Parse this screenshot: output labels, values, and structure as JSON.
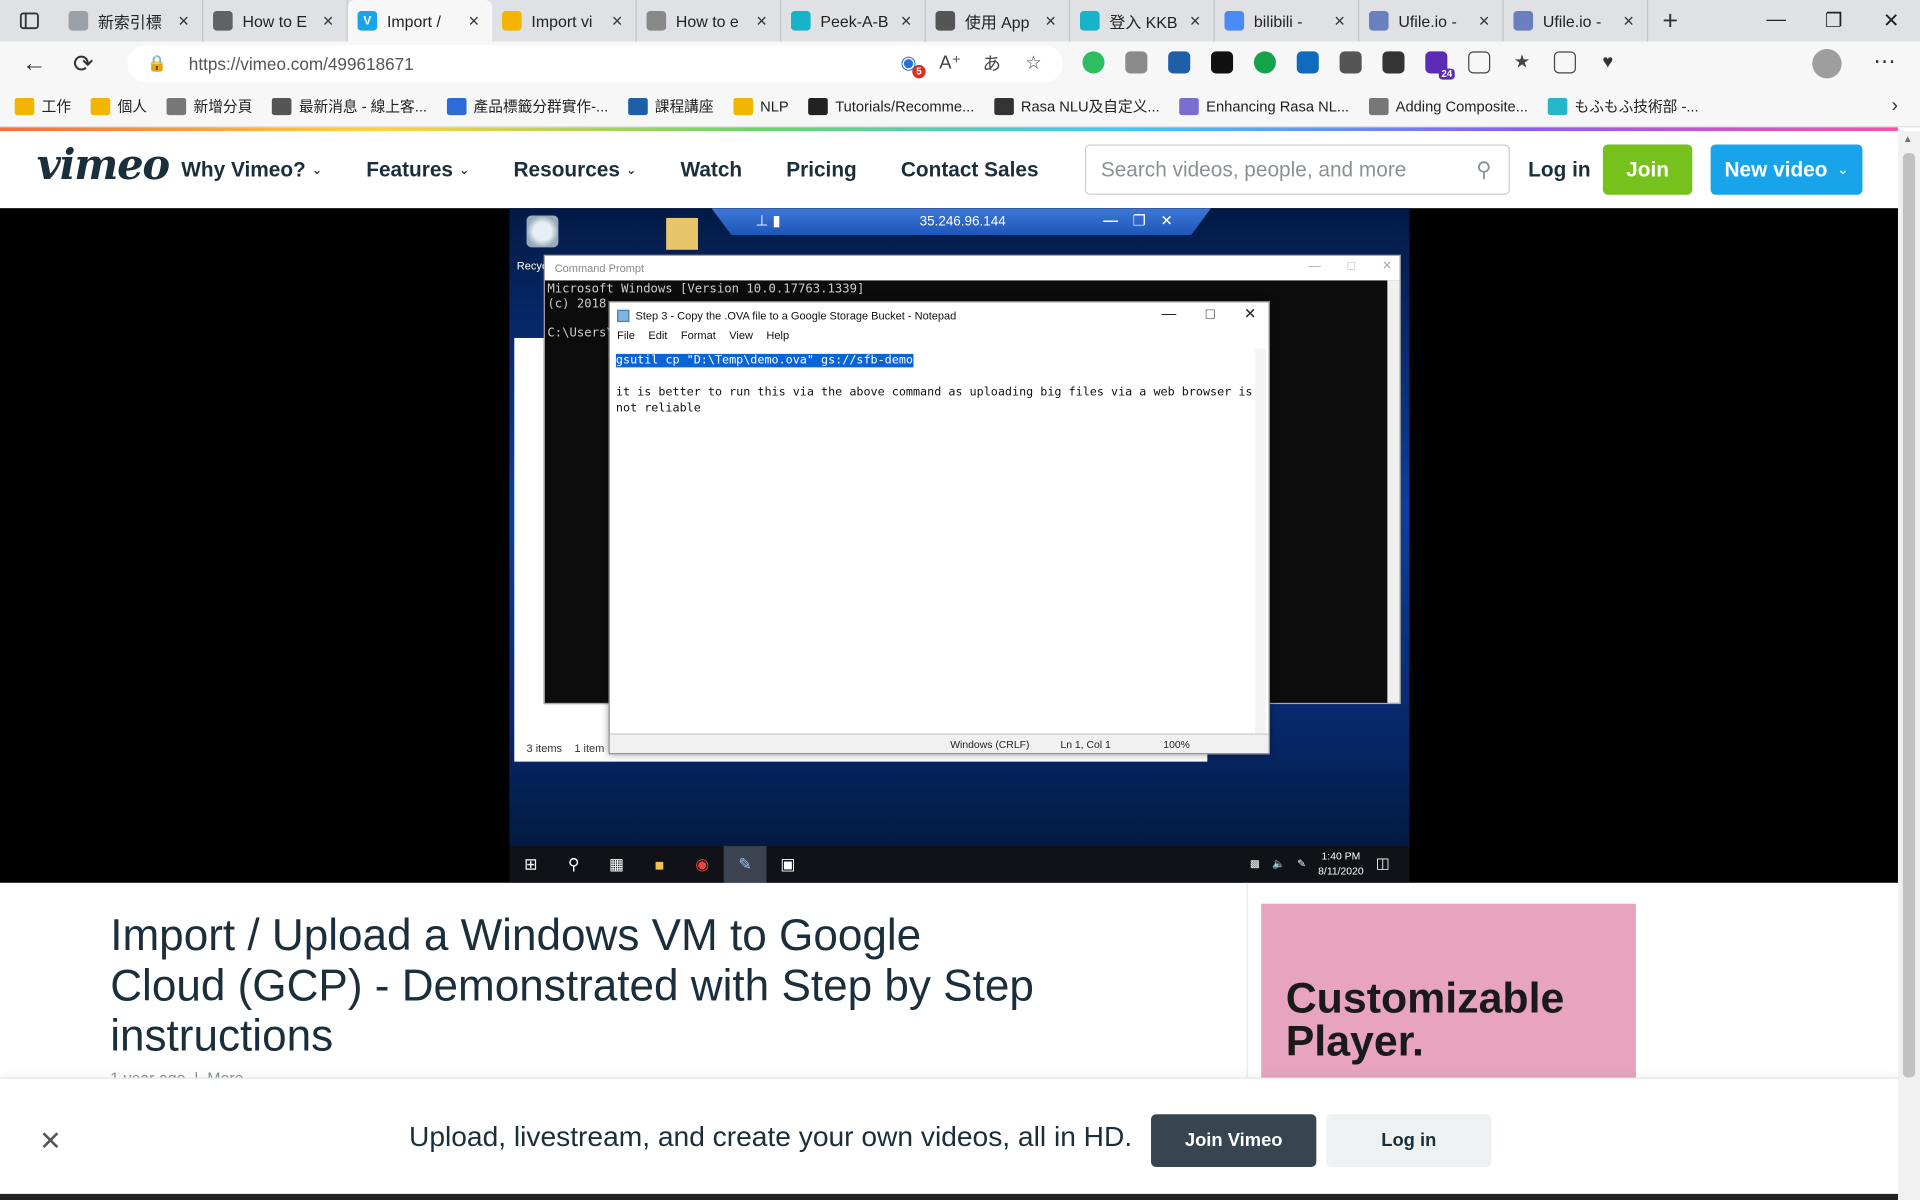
{
  "browser": {
    "tabs": [
      {
        "title": "新索引標",
        "fav_color": "#9aa0a6"
      },
      {
        "title": "How to E",
        "fav_color": "#5f6368"
      },
      {
        "title": "Import / ",
        "fav_color": "#17a4ea",
        "fav_glyph": "V"
      },
      {
        "title": "Import vi",
        "fav_color": "#f4b400"
      },
      {
        "title": "How to e",
        "fav_color": "#888888"
      },
      {
        "title": "Peek-A-B",
        "fav_color": "#17b3c9"
      },
      {
        "title": "使用 App",
        "fav_color": "#555555"
      },
      {
        "title": "登入 KKB",
        "fav_color": "#17b3c9"
      },
      {
        "title": "bilibili - ",
        "fav_color": "#4a8af4"
      },
      {
        "title": "Ufile.io - ",
        "fav_color": "#6a7fbf"
      },
      {
        "title": "Ufile.io - ",
        "fav_color": "#6a7fbf"
      }
    ],
    "url": "https://vimeo.com/499618671",
    "shield_badge": "5",
    "ext_badge": "24",
    "bookmarks": [
      {
        "label": "工作",
        "color": "#f2b600"
      },
      {
        "label": "個人",
        "color": "#f2b600"
      },
      {
        "label": "新增分頁",
        "color": "#777777"
      },
      {
        "label": "最新消息 - 線上客...",
        "color": "#555555"
      },
      {
        "label": "產品標籤分群實作-...",
        "color": "#2d6cd8"
      },
      {
        "label": "課程講座",
        "color": "#1f5fa8"
      },
      {
        "label": "NLP",
        "color": "#f2b600"
      },
      {
        "label": "Tutorials/Recomme...",
        "color": "#222222"
      },
      {
        "label": "Rasa NLU及自定义...",
        "color": "#333333"
      },
      {
        "label": "Enhancing Rasa NL...",
        "color": "#7a6fd0"
      },
      {
        "label": "Adding Composite...",
        "color": "#777777"
      },
      {
        "label": "もふもふ技術部 -...",
        "color": "#26b6c9"
      }
    ]
  },
  "vimeo": {
    "logo": "vimeo",
    "menu": [
      {
        "label": "Why Vimeo?",
        "dropdown": true
      },
      {
        "label": "Features",
        "dropdown": true
      },
      {
        "label": "Resources",
        "dropdown": true
      },
      {
        "label": "Watch",
        "dropdown": false
      },
      {
        "label": "Pricing",
        "dropdown": false
      },
      {
        "label": "Contact Sales",
        "dropdown": false
      }
    ],
    "search_placeholder": "Search videos, people, and more",
    "login": "Log in",
    "join": "Join",
    "new_video": "New video"
  },
  "video_frame": {
    "rdp_ip": "35.246.96.144",
    "recycle_label": "Recyc",
    "cmd_title": "Command Prompt",
    "cmd_lines": [
      "Microsoft Windows [Version 10.0.17763.1339]",
      "(c) 2018",
      "",
      "C:\\Users\\"
    ],
    "explorer_status_items": "3 items",
    "explorer_status_selected": "1 item",
    "notepad_title": "Step 3 - Copy the .OVA file to a Google Storage Bucket - Notepad",
    "notepad_menu": [
      "File",
      "Edit",
      "Format",
      "View",
      "Help"
    ],
    "notepad_line1": "gsutil cp \"D:\\Temp\\demo.ova\" gs://sfb-demo",
    "notepad_line2": "it is better to run this via the above command as uploading big files via a web browser is",
    "notepad_line3": "not reliable",
    "notepad_status": {
      "eol": "Windows (CRLF)",
      "pos": "Ln 1, Col 1",
      "zoom": "100%"
    },
    "clock_time": "1:40 PM",
    "clock_date": "8/11/2020"
  },
  "video": {
    "title": "Import / Upload a Windows VM to Google Cloud (GCP) - Demonstrated with Step by Step instructions",
    "age": "1 year ago",
    "more": "More"
  },
  "ad": {
    "line1": "Customizable",
    "line2": "Player."
  },
  "banner": {
    "message": "Upload, livestream, and create your own videos, all in HD.",
    "join": "Join Vimeo",
    "login": "Log in"
  }
}
